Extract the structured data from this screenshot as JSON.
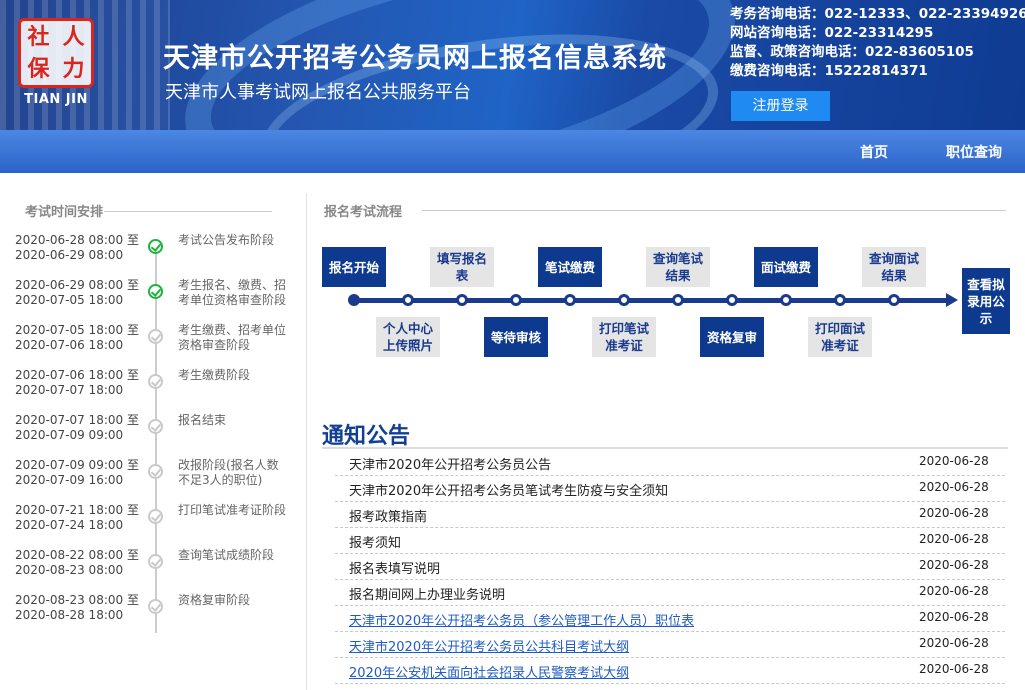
{
  "header": {
    "logo_chars": [
      "社",
      "人",
      "保",
      "力"
    ],
    "logo_en": "TIAN JIN",
    "title": "天津市公开招考公务员网上报名信息系统",
    "subtitle": "天津市人事考试网上报名公共服务平台",
    "contacts": [
      "考务咨询电话：022-12333、022-23394926",
      "网站咨询电话：022-23314295",
      "监督、政策咨询电话：022-83605105",
      "缴费咨询电话：15222814371"
    ],
    "register_button": "注册登录"
  },
  "nav": {
    "home": "首页",
    "position_query": "职位查询"
  },
  "schedule": {
    "title": "考试时间安排",
    "steps": [
      {
        "time": "2020-06-28 08:00 至\n2020-06-29 08:00",
        "label": "考试公告发布阶段",
        "status": "done"
      },
      {
        "time": "2020-06-29 08:00 至\n2020-07-05 18:00",
        "label": "考生报名、缴费、招考单位资格审查阶段",
        "status": "done"
      },
      {
        "time": "2020-07-05 18:00 至\n2020-07-06 18:00",
        "label": "考生缴费、招考单位资格审查阶段",
        "status": "pending"
      },
      {
        "time": "2020-07-06 18:00 至\n2020-07-07 18:00",
        "label": "考生缴费阶段",
        "status": "pending"
      },
      {
        "time": "2020-07-07 18:00 至\n2020-07-09 09:00",
        "label": "报名结束",
        "status": "pending"
      },
      {
        "time": "2020-07-09 09:00 至\n2020-07-09 16:00",
        "label": "改报阶段(报名人数不足3人的职位)",
        "status": "pending"
      },
      {
        "time": "2020-07-21 18:00 至\n2020-07-24 18:00",
        "label": "打印笔试准考证阶段",
        "status": "pending"
      },
      {
        "time": "2020-08-22 08:00 至\n2020-08-23 08:00",
        "label": "查询笔试成绩阶段",
        "status": "pending"
      },
      {
        "time": "2020-08-23 08:00 至\n2020-08-28 18:00",
        "label": "资格复审阶段",
        "status": "pending"
      }
    ]
  },
  "process": {
    "title": "报名考试流程",
    "steps": [
      "报名开始",
      "个人中心上传照片",
      "填写报名表",
      "等待审核",
      "笔试缴费",
      "打印笔试准考证",
      "查询笔试结果",
      "资格复审",
      "面试缴费",
      "打印面试准考证",
      "查询面试结果",
      "查看拟录用公示"
    ]
  },
  "notices": {
    "title": "通知公告",
    "items": [
      {
        "title": "天津市2020年公开招考公务员公告",
        "date": "2020-06-28",
        "link": false
      },
      {
        "title": "天津市2020年公开招考公务员笔试考生防疫与安全须知",
        "date": "2020-06-28",
        "link": false
      },
      {
        "title": "报考政策指南",
        "date": "2020-06-28",
        "link": false
      },
      {
        "title": "报考须知",
        "date": "2020-06-28",
        "link": false
      },
      {
        "title": "报名表填写说明",
        "date": "2020-06-28",
        "link": false
      },
      {
        "title": "报名期间网上办理业务说明",
        "date": "2020-06-28",
        "link": false
      },
      {
        "title": "天津市2020年公开招考公务员（参公管理工作人员）职位表",
        "date": "2020-06-28",
        "link": true
      },
      {
        "title": "天津市2020年公开招考公务员公共科目考试大纲",
        "date": "2020-06-28",
        "link": true
      },
      {
        "title": "2020年公安机关面向社会招录人民警察考试大纲",
        "date": "2020-06-28",
        "link": true
      }
    ]
  },
  "colors": {
    "header_blue": "#1a4aa6",
    "nav_blue": "#2c63c8",
    "process_dark": "#0d3a8f",
    "check_green": "#1cb33e",
    "link_blue": "#1f5bc4"
  }
}
